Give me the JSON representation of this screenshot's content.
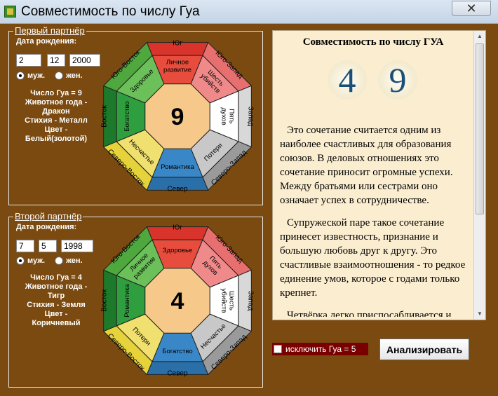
{
  "window": {
    "title": "Совместимость по числу Гуа",
    "close_symbol": "✕"
  },
  "partner1": {
    "legend": "Первый партнёр",
    "date_label": "Дата рождения:",
    "day": "2",
    "month": "12",
    "year": "2000",
    "male_label": "муж.",
    "female_label": "жен.",
    "gender": "male",
    "gua_line": "Число Гуа =  9",
    "animal_line1": "Животное года -",
    "animal_line2": "Дракон",
    "element_line1": "Стихия -  Металл",
    "color_line1": "Цвет -",
    "color_line2": "Белый(золотой)",
    "center_number": "9",
    "sectors": [
      {
        "label": "Личное развитие",
        "color": "#e74c3c"
      },
      {
        "label": "Шесть убийств",
        "color": "#f08a8a"
      },
      {
        "label": "Пять духов",
        "color": "#ffffff"
      },
      {
        "label": "Потери",
        "color": "#c8c8c8"
      },
      {
        "label": "Романтика",
        "color": "#3a87c8"
      },
      {
        "label": "Несчастье",
        "color": "#f0e070"
      },
      {
        "label": "Богатство",
        "color": "#2e9e3e"
      },
      {
        "label": "Здоровье",
        "color": "#6cc05a"
      }
    ],
    "directions": [
      "Юг",
      "Юго-Запад",
      "Запад",
      "Северо-Запад",
      "Север",
      "Северо-Восток",
      "Восток",
      "Юго-Восток"
    ]
  },
  "partner2": {
    "legend": "Второй партнёр",
    "date_label": "Дата рождения:",
    "day": "7",
    "month": "5",
    "year": "1998",
    "male_label": "муж.",
    "female_label": "жен.",
    "gender": "male",
    "gua_line": "Число Гуа =  4",
    "animal_line1": "Животное года -",
    "animal_line2": "Тигр",
    "element_line1": "Стихия -  Земля",
    "color_line1": "Цвет -",
    "color_line2": "Коричневый",
    "center_number": "4",
    "sectors": [
      {
        "label": "Здоровье",
        "color": "#e74c3c"
      },
      {
        "label": "Пять духов",
        "color": "#f08a8a"
      },
      {
        "label": "Шесть убийств",
        "color": "#ffffff"
      },
      {
        "label": "Несчастье",
        "color": "#c8c8c8"
      },
      {
        "label": "Богатство",
        "color": "#3a87c8"
      },
      {
        "label": "Потери",
        "color": "#f0e070"
      },
      {
        "label": "Романтика",
        "color": "#2e9e3e"
      },
      {
        "label": "Личное развитие",
        "color": "#6cc05a"
      }
    ],
    "directions": [
      "Юг",
      "Юго-Запад",
      "Запад",
      "Северо-Запад",
      "Север",
      "Северо-Восток",
      "Восток",
      "Юго-Восток"
    ]
  },
  "octagon_colors": {
    "ring": [
      "#d9342b",
      "#e86f6f",
      "#d8d8d8",
      "#9a9a9a",
      "#2a6fa8",
      "#e6d23a",
      "#1d7a2a",
      "#4ea83e"
    ],
    "center": "#f6c98a"
  },
  "result": {
    "title": "Совместимость по числу ГУА",
    "number1": "4",
    "number2": "9",
    "paragraphs": [
      "Это сочетание считается одним из наиболее счастливых для образования союзов. В деловых отношениях это сочетание приносит огромные успехи. Между братьями или сестрами оно означает успех в сотрудничестве.",
      "Супружеской паре такое сочетание принесет известность, признание и большую любовь друг к другу. Это счастливые взаимоотношения - то редкое единение умов, которое с годами только крепнет.",
      "Четвёрка легко приспосабливается и стремится к гармонии. Девятке"
    ]
  },
  "controls": {
    "exclude_label": "исключить Гуа = 5",
    "analyze_label": "Анализировать"
  }
}
